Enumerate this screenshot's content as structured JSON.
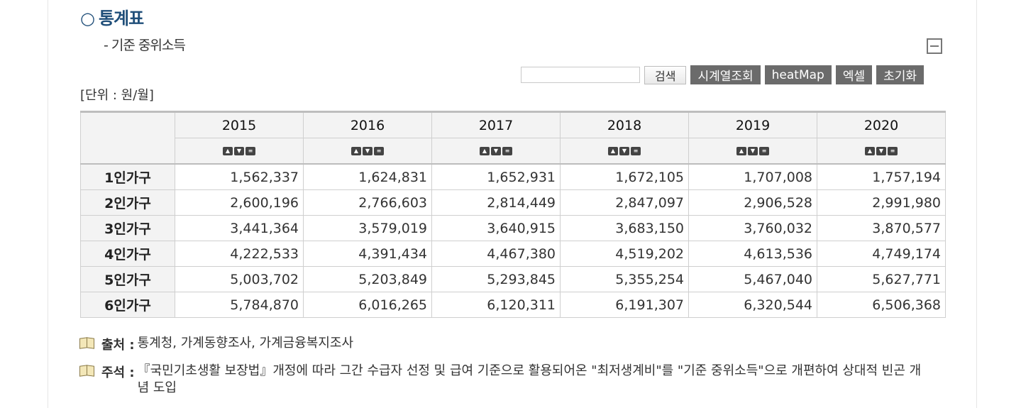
{
  "header": {
    "title_marker": "○",
    "title": "통계표",
    "subtitle": "- 기준 중위소득"
  },
  "toolbar": {
    "search_value": "",
    "search_button": "검색",
    "timeseries_button": "시계열조회",
    "heatmap_button": "heatMap",
    "excel_button": "엑셀",
    "reset_button": "초기화"
  },
  "unit_label": "[단위 : 원/월]",
  "table": {
    "columns": [
      "2015",
      "2016",
      "2017",
      "2018",
      "2019",
      "2020"
    ],
    "sort_icons": [
      "▲",
      "▼",
      "≡"
    ],
    "rows": [
      {
        "label": "1인가구",
        "values": [
          "1,562,337",
          "1,624,831",
          "1,652,931",
          "1,672,105",
          "1,707,008",
          "1,757,194"
        ]
      },
      {
        "label": "2인가구",
        "values": [
          "2,600,196",
          "2,766,603",
          "2,814,449",
          "2,847,097",
          "2,906,528",
          "2,991,980"
        ]
      },
      {
        "label": "3인가구",
        "values": [
          "3,441,364",
          "3,579,019",
          "3,640,915",
          "3,683,150",
          "3,760,032",
          "3,870,577"
        ]
      },
      {
        "label": "4인가구",
        "values": [
          "4,222,533",
          "4,391,434",
          "4,467,380",
          "4,519,202",
          "4,613,536",
          "4,749,174"
        ]
      },
      {
        "label": "5인가구",
        "values": [
          "5,003,702",
          "5,203,849",
          "5,293,845",
          "5,355,254",
          "5,467,040",
          "5,627,771"
        ]
      },
      {
        "label": "6인가구",
        "values": [
          "5,784,870",
          "6,016,265",
          "6,120,311",
          "6,191,307",
          "6,320,544",
          "6,506,368"
        ]
      }
    ]
  },
  "notes": {
    "source_label": "출처 :",
    "source_text": "통계청, 가계동향조사, 가계금융복지조사",
    "comment_label": "주석 :",
    "comment_text": "『국민기초생활 보장법』개정에 따라 그간 수급자 선정 및 급여 기준으로 활용되어온 \"최저생계비\"를 \"기준 중위소득\"으로 개편하여 상대적 빈곤 개념 도입"
  },
  "icons": {
    "collapse": "collapse-minus-icon",
    "note": "book-icon"
  }
}
